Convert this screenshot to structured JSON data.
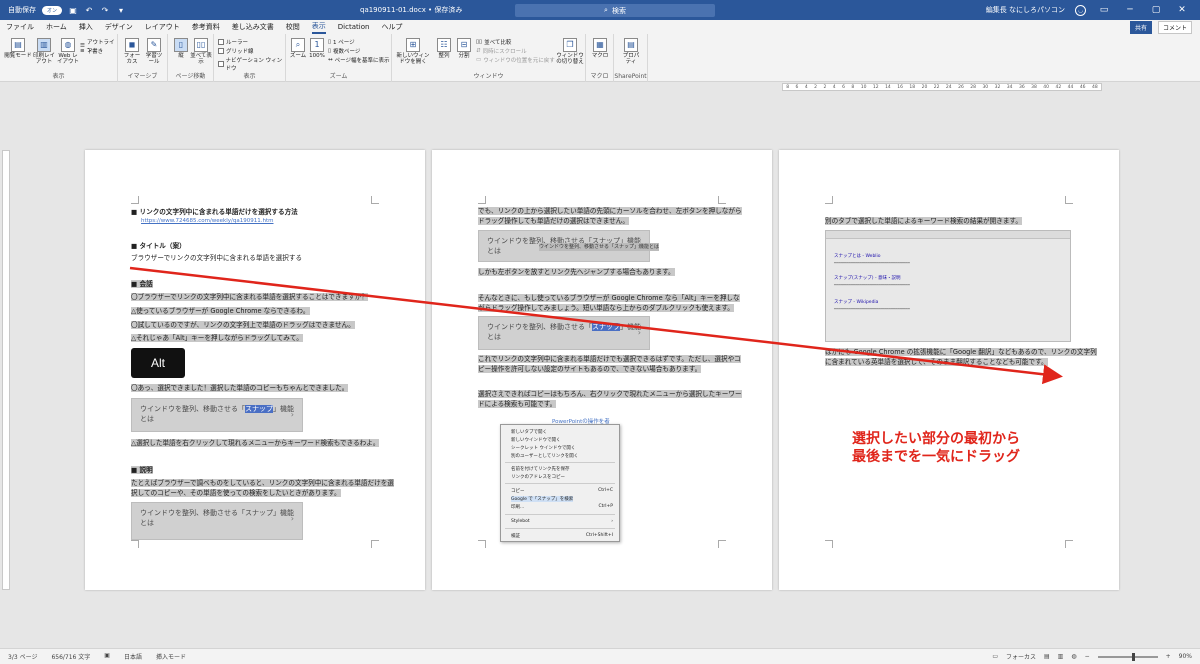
{
  "titlebar": {
    "autosave_label": "自動保存",
    "autosave_state": "オン",
    "filename": "qa190911-01.docx • 保存済み",
    "search_placeholder": "検索",
    "user_name": "編集長 なにしろパソコン"
  },
  "tabs": [
    "ファイル",
    "ホーム",
    "挿入",
    "デザイン",
    "レイアウト",
    "参考資料",
    "差し込み文書",
    "校閲",
    "表示",
    "Dictation",
    "ヘルプ"
  ],
  "active_tab": "表示",
  "share_label": "共有",
  "comment_label": "コメント",
  "ribbon": {
    "views": {
      "read_mode": "閲覧モード",
      "print_layout": "印刷レイアウト",
      "web_layout": "Web レイアウト",
      "outline": "アウトライン",
      "draft": "下書き",
      "group": "表示"
    },
    "immersive": {
      "focus": "フォーカス",
      "learning": "学習ツール",
      "group": "イマーシブ"
    },
    "page_movement": {
      "vertical": "縦",
      "side_by_side": "並べて表示",
      "group": "ページ移動"
    },
    "show": {
      "ruler": "ルーラー",
      "gridlines": "グリッド線",
      "nav_pane": "ナビゲーション ウィンドウ",
      "group": "表示"
    },
    "zoom": {
      "zoom": "ズーム",
      "percent": "100%",
      "one_page": "1 ページ",
      "multi_page": "複数ページ",
      "page_width": "ページ幅を基準に表示",
      "group": "ズーム"
    },
    "window": {
      "new_window": "新しいウィンドウを開く",
      "arrange": "整列",
      "split": "分割",
      "side_compare": "並べて比較",
      "sync_scroll": "同時にスクロール",
      "reset_pos": "ウィンドウの位置を元に戻す",
      "switch": "ウィンドウの切り替え",
      "group": "ウィンドウ"
    },
    "macro": {
      "macro": "マクロ",
      "group": "マクロ"
    },
    "sharepoint": {
      "properties": "プロパティ",
      "group": "SharePoint"
    }
  },
  "ruler_numbers": [
    "8",
    "6",
    "4",
    "2",
    "2",
    "4",
    "6",
    "8",
    "10",
    "12",
    "14",
    "16",
    "18",
    "20",
    "22",
    "24",
    "26",
    "28",
    "30",
    "32",
    "34",
    "36",
    "38",
    "40",
    "42",
    "44",
    "46",
    "48"
  ],
  "page1": {
    "h1": "■ リンクの文字列中に含まれる単語だけを選択する方法",
    "url": "https://www.724685.com/weekly/qa190911.htm",
    "h2": "■ タイトル（案）",
    "t1": "ブラウザーでリンクの文字列中に含まれる単語を選択する",
    "h3": "■ 会話",
    "c1": "〇ブラウザーでリンクの文字列中に含まれる単語を選択することはできますか？",
    "c2": "△使っているブラウザーが Google Chrome ならできるわ。",
    "c3": "〇試しているのですが、リンクの文字列上で単語のドラッグはできません。",
    "c4": "△それじゃあ「Alt」キーを押しながらドラッグしてみて。",
    "alt_key": "Alt",
    "c5": "〇あっ、選択できました！選択した単語のコピーもちゃんとできました。",
    "snippet1_pre": "ウインドウを整列、移動させる「",
    "snippet1_sel": "スナップ",
    "snippet1_post": "」機能",
    "snippet1_line2": "とは",
    "c6": "△選択した単語を右クリックして現れるメニューからキーワード検索もできるわよ。",
    "h4": "■ 説明",
    "d1": "たとえばブラウザーで調べものをしていると、リンクの文字列中に含まれる単語だけを選",
    "d2": "択してのコピーや、その単語を使っての検索をしたいときがあります。",
    "snippet2_line1": "ウインドウを整列、移動させる「スナップ」機能",
    "snippet2_line2": "とは"
  },
  "page2": {
    "p1": "でも、リンクの上から選択したい単語の先頭にカーソルを合わせ、左ボタンを押しながら",
    "p2": "ドラッグ操作しても単語だけの選択はできません。",
    "snippet_line1": "ウインドウを整列、移動させる「スナップ」機能",
    "snippet_line2": "とは",
    "drag_tip": "ウインドウを整列、移動させる「スナップ」機能とは",
    "p3": "しかも左ボタンを放すとリンク先へジャンプする場合もあります。",
    "p4": "そんなときに、もし使っているブラウザーが Google Chrome なら「Alt」キーを押しな",
    "p5": "がらドラッグ操作してみましょう。短い単語なら上からのダブルクリックも使えます。",
    "snippet3_pre": "ウインドウを整列、移動させる「",
    "snippet3_sel": "スナップ",
    "snippet3_post": "」機能",
    "snippet3_line2": "とは",
    "p6": "これでリンクの文字列中に含まれる単語だけでも選択できるはずです。ただし、選択やコ",
    "p7": "ピー操作を許可しない設定のサイトもあるので、できない場合もあります。",
    "p8": "選択さえできればコピーはもちろん、右クリックで現れたメニューから選択したキーワー",
    "p9": "ドによる検索も可能です。",
    "bg_link": "PowerPointの操作を者",
    "ctx_items": [
      "新しいタブで開く",
      "新しいウインドウで開く",
      "シークレット ウインドウで開く",
      "別のユーザーとしてリンクを開く",
      "名前を付けてリンク先を保存",
      "リンクのアドレスをコピー",
      "コピー",
      "Google で「スナップ」を検索",
      "印刷...",
      "Stylebot",
      "検証"
    ],
    "ctx_shortcuts": {
      "copy": "Ctrl+C",
      "print": "Ctrl+P",
      "inspect": "Ctrl+Shift+I"
    }
  },
  "page3": {
    "p1": "別のタブで選択した単語によるキーワード検索の結果が開きます。",
    "thumb_results": [
      "スナップとは - Weblio",
      "スナップ(スナップ) - 意味・説明",
      "スナップ - Wikipedia"
    ],
    "p2": "ほかにも Google Chrome の拡張機能に「Google 翻訳」などもあるので、リンクの文字列",
    "p3": "に含まれている英単語を選択して、そのまま翻訳することなども可能です。"
  },
  "annotation": {
    "line1": "選択したい部分の最初から",
    "line2": "最後までを一気にドラッグ"
  },
  "statusbar": {
    "page": "3/3 ページ",
    "words": "656/716 文字",
    "lang": "日本語",
    "mode": "挿入モード",
    "focus": "フォーカス",
    "zoom": "90%"
  },
  "colors": {
    "accent": "#2b579a",
    "annotation": "#e0251b",
    "highlight": "#c8c8c8"
  }
}
